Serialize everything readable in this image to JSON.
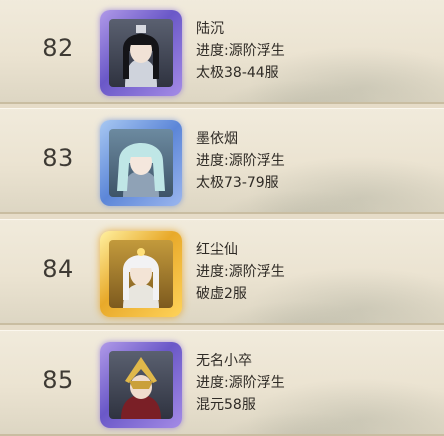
{
  "players": [
    {
      "rank": "82",
      "name": "陆沉",
      "progress": "进度:源阶浮生",
      "server": "太极38-44服",
      "frame_color": "#8a74dc",
      "avatar_icon": "portrait-icon"
    },
    {
      "rank": "83",
      "name": "墨依烟",
      "progress": "进度:源阶浮生",
      "server": "太极73-79服",
      "frame_color": "#6f95e0",
      "avatar_icon": "portrait-icon"
    },
    {
      "rank": "84",
      "name": "红尘仙",
      "progress": "进度:源阶浮生",
      "server": "破虚2服",
      "frame_color": "#e8a92a",
      "avatar_icon": "portrait-icon"
    },
    {
      "rank": "85",
      "name": "无名小卒",
      "progress": "进度:源阶浮生",
      "server": "混元58服",
      "frame_color": "#8a74dc",
      "avatar_icon": "portrait-icon"
    }
  ]
}
